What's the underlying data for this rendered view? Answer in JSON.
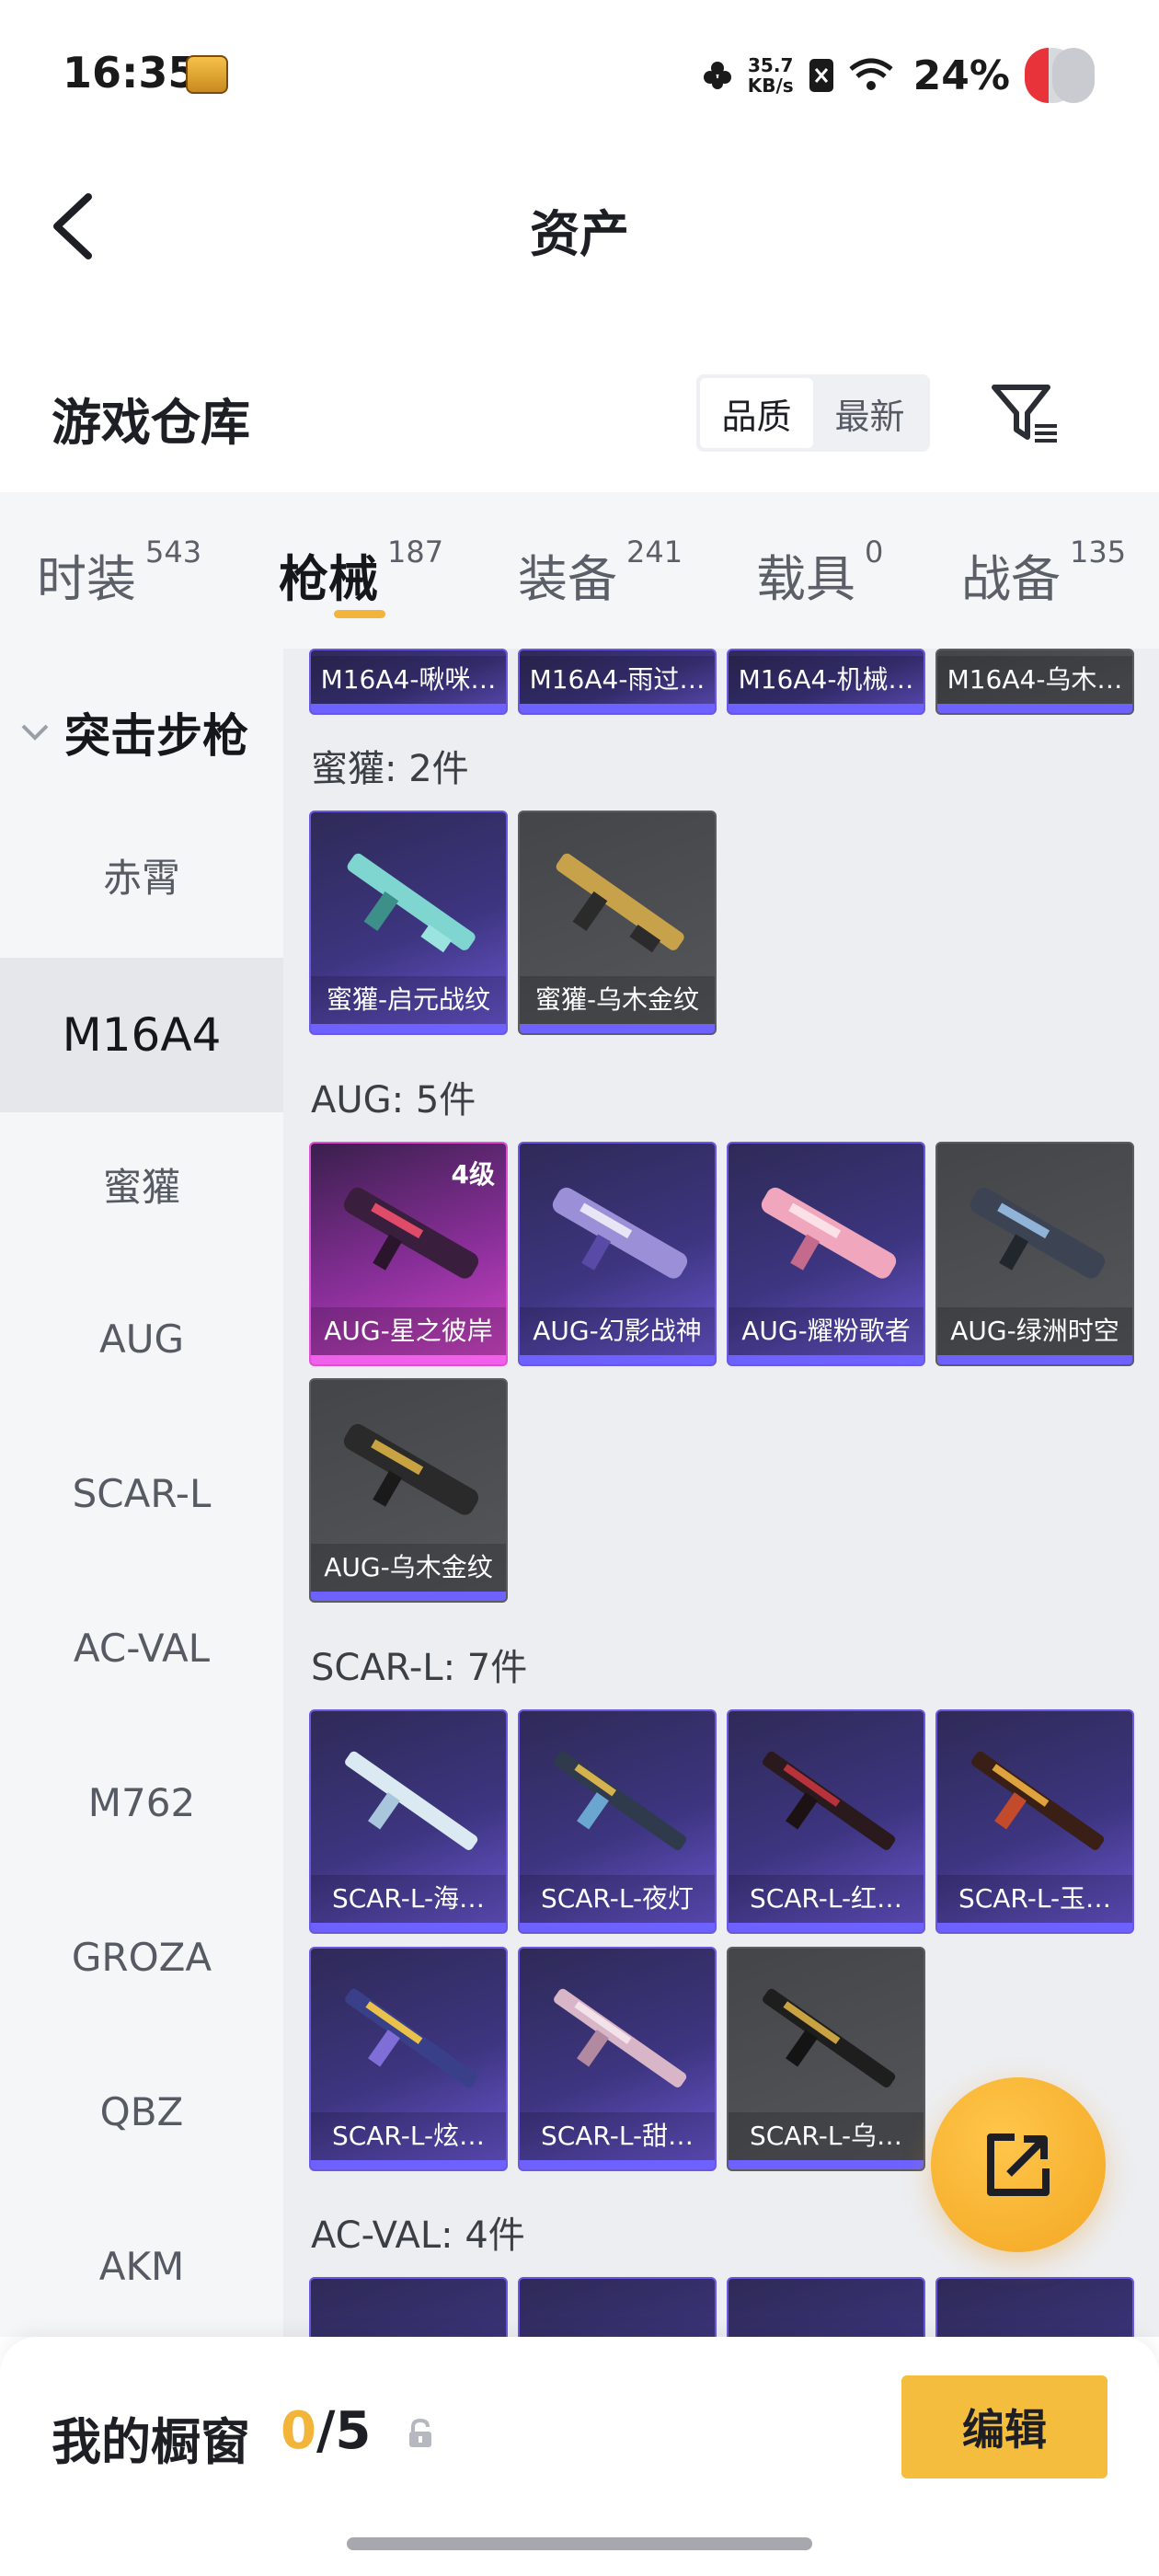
{
  "status_bar": {
    "time": "16:35",
    "net_speed_value": "35.7",
    "net_speed_unit": "KB/s",
    "battery": "24%"
  },
  "header": {
    "title": "资产"
  },
  "warehouse": {
    "title": "游戏仓库",
    "sort_options": [
      "品质",
      "最新"
    ],
    "active_sort": "品质"
  },
  "tabs": [
    {
      "label": "时装",
      "count": "543"
    },
    {
      "label": "枪械",
      "count": "187"
    },
    {
      "label": "装备",
      "count": "241"
    },
    {
      "label": "载具",
      "count": "0"
    },
    {
      "label": "战备",
      "count": "135"
    }
  ],
  "active_tab": "枪械",
  "sidebar": {
    "category": "突击步枪",
    "items": [
      "赤霄",
      "M16A4",
      "蜜獾",
      "AUG",
      "SCAR-L",
      "AC-VAL",
      "M762",
      "GROZA",
      "QBZ",
      "AKM"
    ],
    "active_item": "M16A4"
  },
  "groups": {
    "m16_partial": {
      "items": [
        "M16A4-啾咪…",
        "M16A4-雨过…",
        "M16A4-机械…",
        "M16A4-乌木…"
      ]
    },
    "honey_badger": {
      "title": "蜜獾: 2件",
      "items": [
        "蜜獾-启元战纹",
        "蜜獾-乌木金纹"
      ]
    },
    "aug": {
      "title": "AUG: 5件",
      "level_badge": "4级",
      "items": [
        "AUG-星之彼岸",
        "AUG-幻影战神",
        "AUG-耀粉歌者",
        "AUG-绿洲时空",
        "AUG-乌木金纹"
      ]
    },
    "scar": {
      "title": "SCAR-L: 7件",
      "items": [
        "SCAR-L-海…",
        "SCAR-L-夜灯",
        "SCAR-L-红…",
        "SCAR-L-玉…",
        "SCAR-L-炫…",
        "SCAR-L-甜…",
        "SCAR-L-乌…"
      ]
    },
    "acval": {
      "title": "AC-VAL: 4件"
    }
  },
  "showcase": {
    "title": "我的橱窗",
    "current": "0",
    "separator": "/",
    "max": "5",
    "edit_label": "编辑"
  },
  "colors": {
    "accent": "#f3b43a",
    "card_violet": "#3d3580",
    "card_gray": "#55575b",
    "card_pink": "#d247c8",
    "rarity_stripe": "#6d62ff"
  },
  "icons": [
    "back-arrow-icon",
    "filter-icon",
    "chevron-down-icon",
    "share-icon",
    "lock-icon"
  ]
}
